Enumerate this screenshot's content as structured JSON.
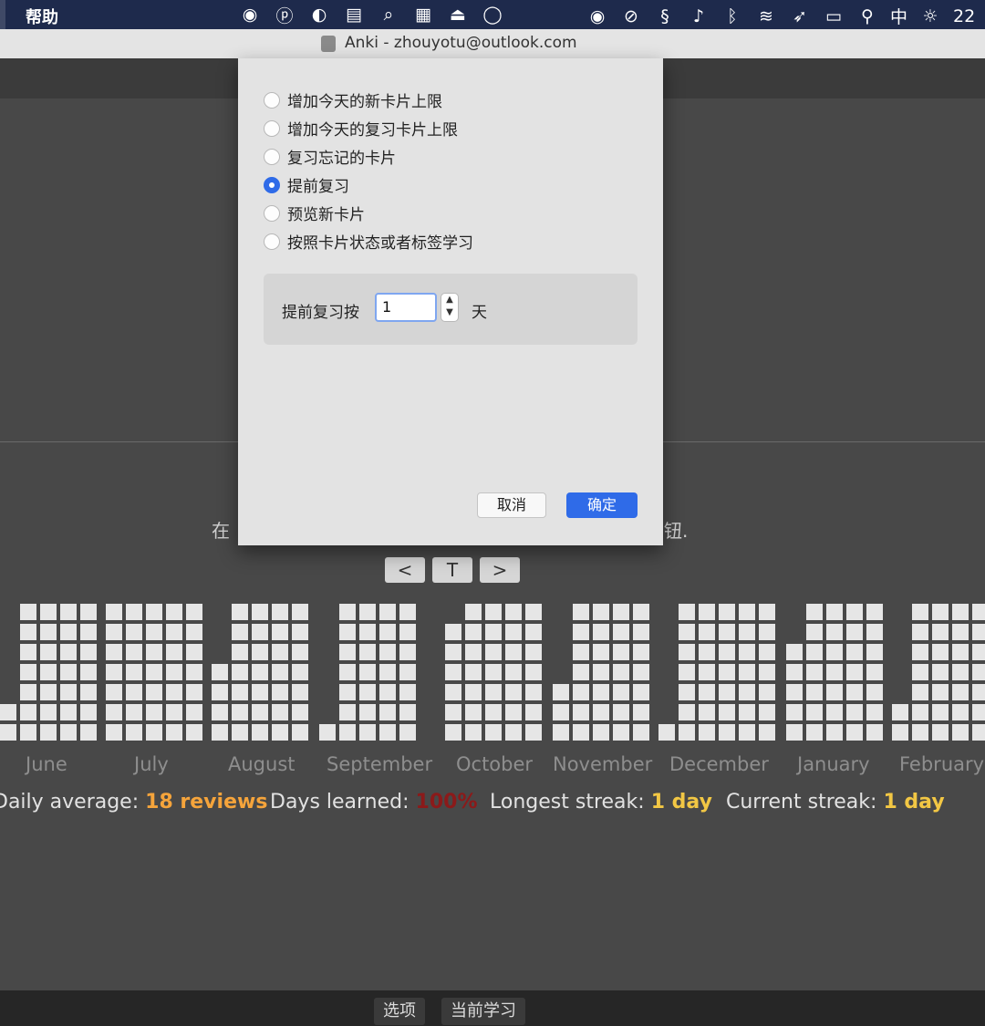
{
  "menubar": {
    "help": "帮助",
    "ime": "中",
    "time": "22",
    "icons": [
      "record-icon",
      "p-icon",
      "moon-icon",
      "stack-icon",
      "search-icon",
      "grid-icon",
      "hat-icon",
      "circle-icon",
      "eye-icon",
      "block-icon",
      "s-icon",
      "volume-icon",
      "bluetooth-icon",
      "wifi-icon",
      "send-icon",
      "display-icon",
      "spotlight-icon"
    ]
  },
  "window": {
    "title": "Anki - zhouyotu@outlook.com"
  },
  "dialog": {
    "options": [
      {
        "label": "增加今天的新卡片上限",
        "selected": false
      },
      {
        "label": "增加今天的复习卡片上限",
        "selected": false
      },
      {
        "label": "复习忘记的卡片",
        "selected": false
      },
      {
        "label": "提前复习",
        "selected": true
      },
      {
        "label": "预览新卡片",
        "selected": false
      },
      {
        "label": "按照卡片状态或者标签学习",
        "selected": false
      }
    ],
    "review_ahead_label": "提前复习按",
    "review_ahead_value": "1",
    "review_ahead_unit": "天",
    "cancel_label": "取消",
    "ok_label": "确定"
  },
  "background": {
    "message_prefix": "在",
    "message_suffix": "钮.",
    "nav": {
      "prev": "<",
      "today": "T",
      "next": ">"
    }
  },
  "heatmap": {
    "months": [
      "June",
      "July",
      "August",
      "September",
      "October",
      "November",
      "December",
      "January",
      "February"
    ]
  },
  "stats": {
    "daily_average_label": "Daily average:",
    "daily_average_value": "18 reviews",
    "days_learned_label": "Days learned:",
    "days_learned_value": "100%",
    "longest_streak_label": "Longest streak:",
    "longest_streak_value": "1 day",
    "current_streak_label": "Current streak:",
    "current_streak_value": "1 day",
    "colors": {
      "orange": "#f5a43b",
      "red": "#8b1a1a",
      "yellow": "#f2c744"
    }
  },
  "bottombar": {
    "options": "选项",
    "study_now": "当前学习"
  }
}
